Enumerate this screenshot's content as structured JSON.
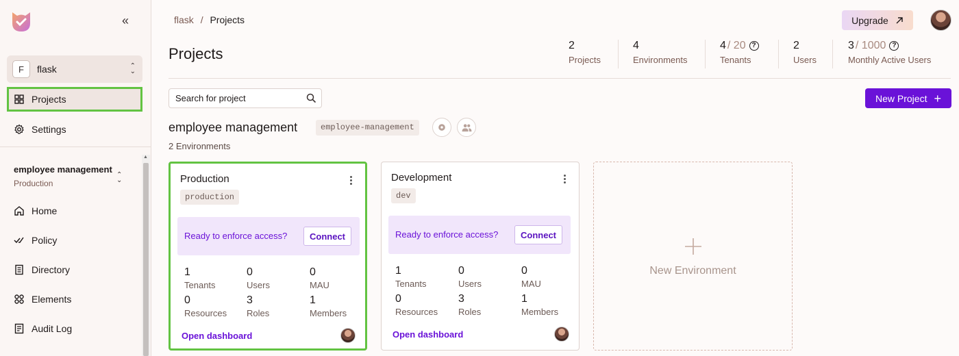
{
  "sidebar": {
    "org": {
      "initial": "F",
      "name": "flask"
    },
    "items": [
      {
        "label": "Projects"
      },
      {
        "label": "Settings"
      }
    ],
    "context": {
      "project": "employee management",
      "environment": "Production"
    },
    "sub_items": [
      {
        "label": "Home"
      },
      {
        "label": "Policy"
      },
      {
        "label": "Directory"
      },
      {
        "label": "Elements"
      },
      {
        "label": "Audit Log"
      }
    ]
  },
  "header": {
    "breadcrumb": {
      "org": "flask",
      "separator": "/",
      "current": "Projects"
    },
    "upgrade_label": "Upgrade",
    "title": "Projects"
  },
  "stats": [
    {
      "value": "2",
      "max": "",
      "label": "Projects",
      "help": false
    },
    {
      "value": "4",
      "max": "",
      "label": "Environments",
      "help": false
    },
    {
      "value": "4",
      "max": "/ 20",
      "label": "Tenants",
      "help": true
    },
    {
      "value": "2",
      "max": "",
      "label": "Users",
      "help": false
    },
    {
      "value": "3",
      "max": "/ 1000",
      "label": "Monthly Active Users",
      "help": true
    }
  ],
  "search": {
    "placeholder": "Search for project"
  },
  "new_project_label": "New Project",
  "project": {
    "name": "employee management",
    "key": "employee-management",
    "env_count": "2 Environments"
  },
  "environments": [
    {
      "name": "Production",
      "key": "production",
      "enforce_text": "Ready to enforce access?",
      "connect_label": "Connect",
      "metrics": [
        {
          "value": "1",
          "label": "Tenants"
        },
        {
          "value": "0",
          "label": "Users"
        },
        {
          "value": "0",
          "label": "MAU"
        },
        {
          "value": "0",
          "label": "Resources"
        },
        {
          "value": "3",
          "label": "Roles"
        },
        {
          "value": "1",
          "label": "Members"
        }
      ],
      "open_label": "Open dashboard"
    },
    {
      "name": "Development",
      "key": "dev",
      "enforce_text": "Ready to enforce access?",
      "connect_label": "Connect",
      "metrics": [
        {
          "value": "1",
          "label": "Tenants"
        },
        {
          "value": "0",
          "label": "Users"
        },
        {
          "value": "0",
          "label": "MAU"
        },
        {
          "value": "0",
          "label": "Resources"
        },
        {
          "value": "3",
          "label": "Roles"
        },
        {
          "value": "1",
          "label": "Members"
        }
      ],
      "open_label": "Open dashboard"
    }
  ],
  "new_environment_label": "New Environment",
  "colors": {
    "accent": "#6a12d8",
    "highlight": "#62c342",
    "enforce_bg": "#f1e6fb"
  }
}
